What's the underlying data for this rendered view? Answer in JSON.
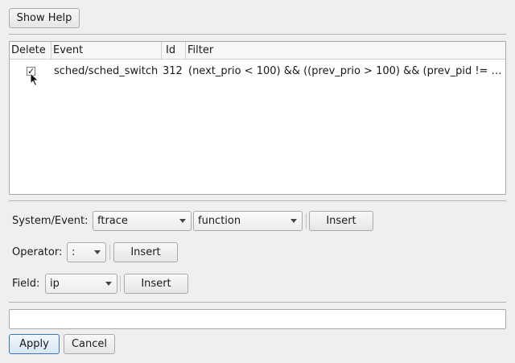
{
  "toolbar": {
    "show_help_label": "Show Help"
  },
  "table": {
    "columns": [
      "Delete",
      "Event",
      "Id",
      "Filter"
    ],
    "rows": [
      {
        "delete_checked": true,
        "event": "sched/sched_switch",
        "id": "312",
        "filter": "(next_prio < 100) && ((prev_prio > 100) && (prev_pid != …"
      }
    ]
  },
  "system_event": {
    "label": "System/Event:",
    "system_value": "ftrace",
    "event_value": "function",
    "insert_label": "Insert"
  },
  "operator": {
    "label": "Operator:",
    "value": ":",
    "insert_label": "Insert"
  },
  "field": {
    "label": "Field:",
    "value": "ip",
    "insert_label": "Insert"
  },
  "filter_input": {
    "value": ""
  },
  "actions": {
    "apply_label": "Apply",
    "cancel_label": "Cancel"
  },
  "icons": {
    "checkbox_mark": "check-icon",
    "pointer": "mouse-pointer-icon",
    "dropdown": "chevron-down-icon"
  }
}
